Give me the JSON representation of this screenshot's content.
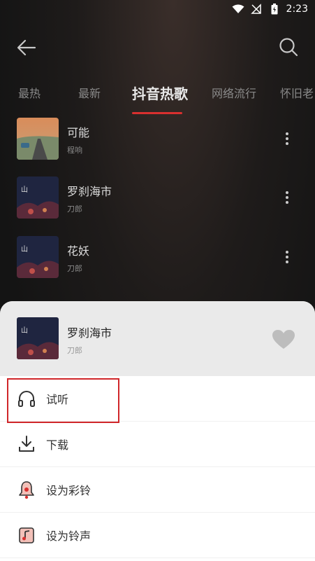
{
  "status_bar": {
    "time": "2:23",
    "icons": [
      "wifi-icon",
      "no-signal-icon",
      "battery-charging-icon"
    ]
  },
  "header": {
    "back_icon": "back-arrow-icon",
    "search_icon": "search-icon"
  },
  "tabs": [
    {
      "label": "最热",
      "active": false
    },
    {
      "label": "最新",
      "active": false
    },
    {
      "label": "抖音热歌",
      "active": true
    },
    {
      "label": "网络流行",
      "active": false
    },
    {
      "label": "怀旧老",
      "active": false
    }
  ],
  "songs": [
    {
      "title": "可能",
      "artist": "程响"
    },
    {
      "title": "罗刹海市",
      "artist": "刀郎"
    },
    {
      "title": "花妖",
      "artist": "刀郎"
    }
  ],
  "sheet": {
    "title": "罗刹海市",
    "artist": "刀郎",
    "menu": [
      {
        "label": "试听",
        "icon": "headphones-icon"
      },
      {
        "label": "下载",
        "icon": "download-icon"
      },
      {
        "label": "设为彩铃",
        "icon": "bell-icon"
      },
      {
        "label": "设为铃声",
        "icon": "ringtone-icon"
      }
    ]
  },
  "colors": {
    "accent": "#d9302f",
    "highlight_box": "#d0262a"
  }
}
